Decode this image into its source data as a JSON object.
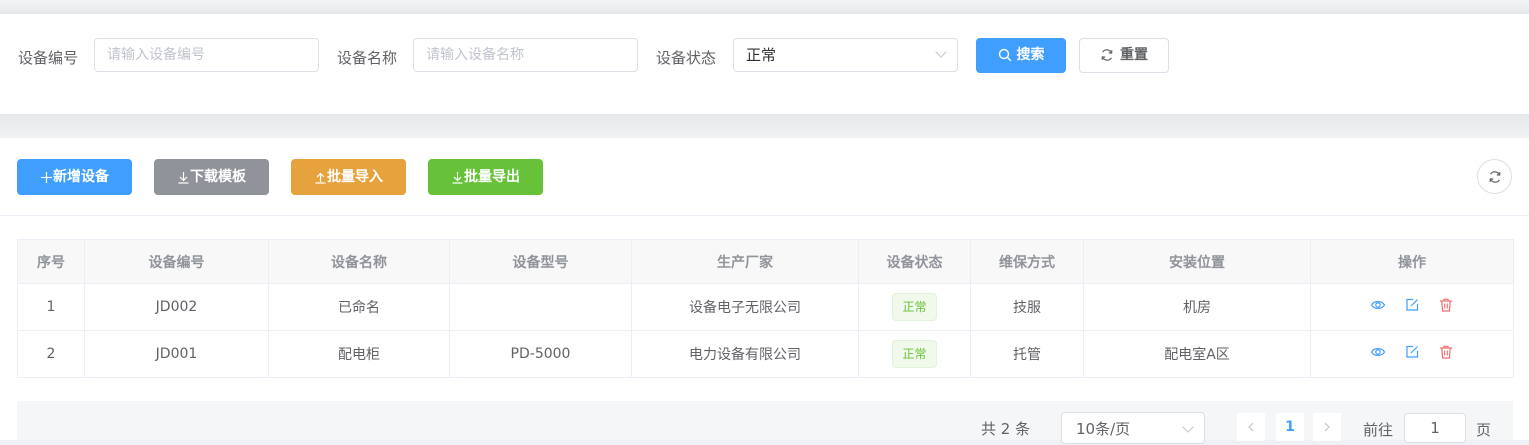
{
  "search": {
    "device_code_label": "设备编号",
    "device_code_placeholder": "请输入设备编号",
    "device_name_label": "设备名称",
    "device_name_placeholder": "请输入设备名称",
    "device_status_label": "设备状态",
    "device_status_value": "正常",
    "search_label": "搜索",
    "reset_label": "重置"
  },
  "toolbar": {
    "add_label": "新增设备",
    "download_template_label": "下载模板",
    "batch_import_label": "批量导入",
    "batch_export_label": "批量导出"
  },
  "table": {
    "columns": [
      "序号",
      "设备编号",
      "设备名称",
      "设备型号",
      "生产厂家",
      "设备状态",
      "维保方式",
      "安装位置",
      "操作"
    ],
    "rows": [
      {
        "index": "1",
        "code": "JD002",
        "name": "已命名",
        "model": "",
        "manufacturer": "设备电子无限公司",
        "status": "正常",
        "maintenance": "技服",
        "location": "机房"
      },
      {
        "index": "2",
        "code": "JD001",
        "name": "配电柜",
        "model": "PD-5000",
        "manufacturer": "电力设备有限公司",
        "status": "正常",
        "maintenance": "托管",
        "location": "配电室A区"
      }
    ]
  },
  "pagination": {
    "total_text": "共 2 条",
    "page_size": "10条/页",
    "current_page": "1",
    "goto_prefix": "前往",
    "goto_value": "1",
    "goto_suffix": "页"
  },
  "colors": {
    "primary": "#409eff",
    "info": "#909399",
    "warning": "#e6a23c",
    "success": "#67c23a",
    "danger": "#f56c6c"
  },
  "icons": [
    "search-icon",
    "refresh-icon",
    "plus-icon",
    "download-icon",
    "upload-icon",
    "view-icon",
    "edit-icon",
    "delete-icon",
    "chevron-down-icon",
    "chevron-left-icon",
    "chevron-right-icon"
  ]
}
